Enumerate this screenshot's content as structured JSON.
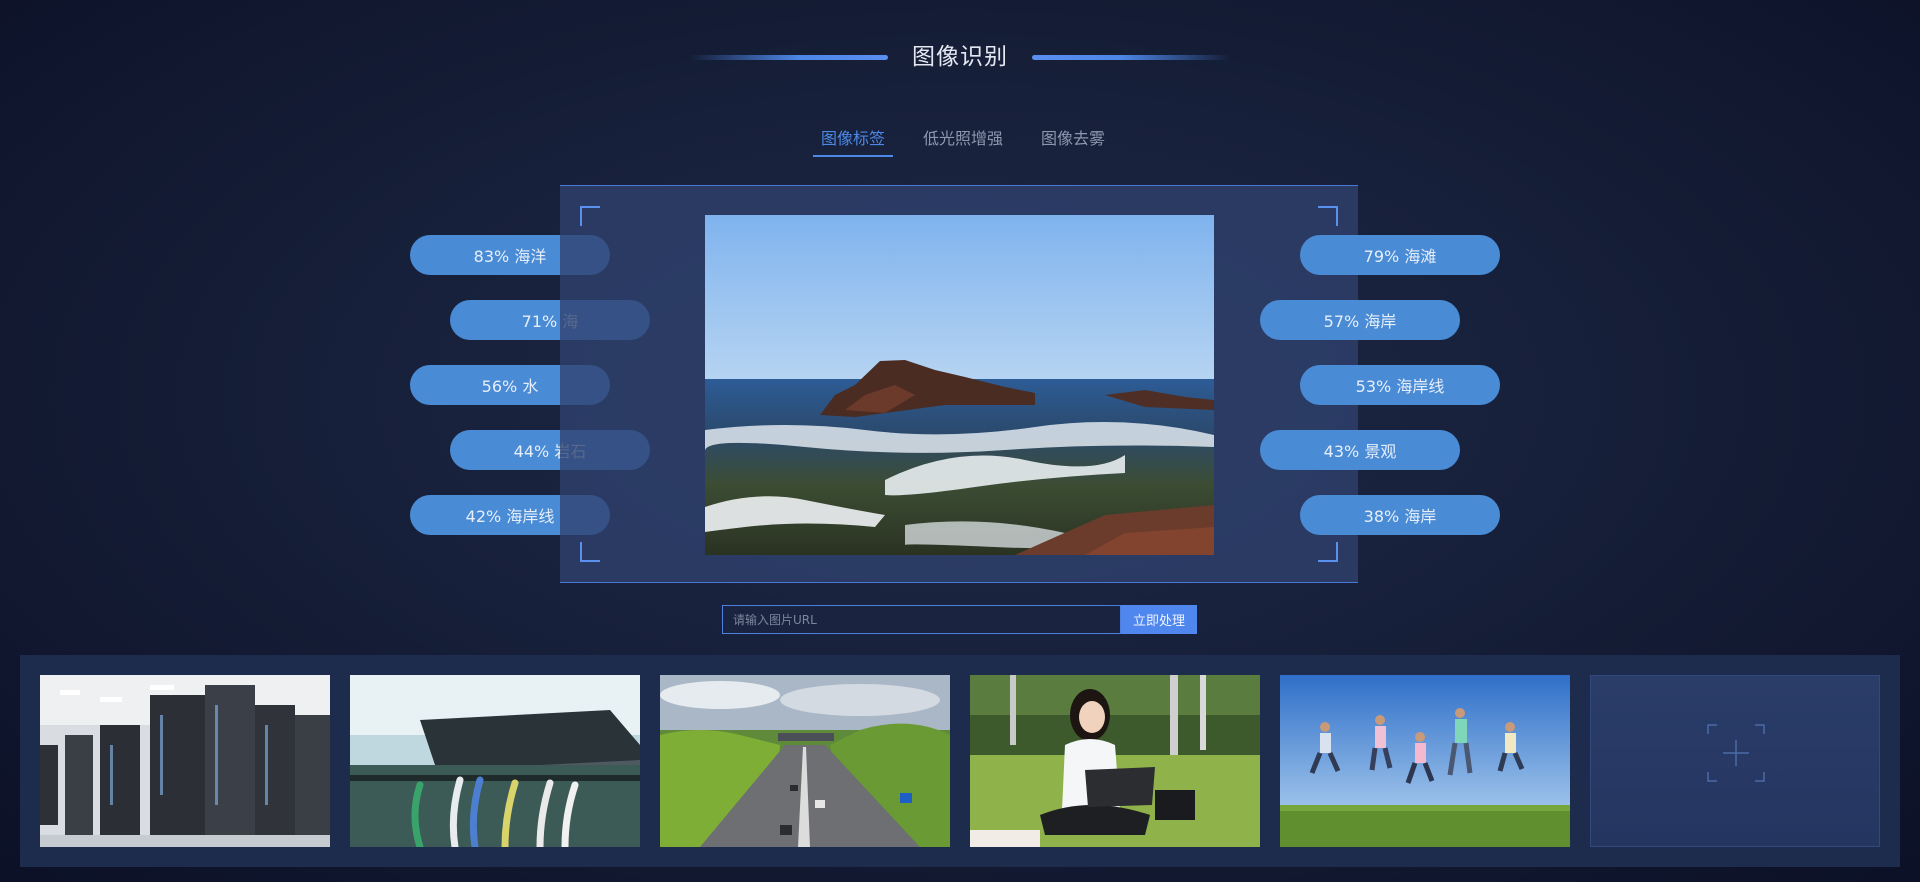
{
  "header": {
    "title": "图像识别"
  },
  "tabs": [
    {
      "label": "图像标签",
      "active": true
    },
    {
      "label": "低光照增强",
      "active": false
    },
    {
      "label": "图像去雾",
      "active": false
    }
  ],
  "tags_left": [
    {
      "label": "83% 海洋"
    },
    {
      "label": "71% 海"
    },
    {
      "label": "56% 水"
    },
    {
      "label": "44% 岩石"
    },
    {
      "label": "42% 海岸线"
    }
  ],
  "tags_right": [
    {
      "label": "79% 海滩"
    },
    {
      "label": "57% 海岸"
    },
    {
      "label": "53% 海岸线"
    },
    {
      "label": "43% 景观"
    },
    {
      "label": "38% 海岸"
    }
  ],
  "url_form": {
    "placeholder": "请输入图片URL",
    "value": "",
    "button_label": "立即处理"
  },
  "thumbnails": [
    {
      "icon": "server-room-photo"
    },
    {
      "icon": "network-router-photo"
    },
    {
      "icon": "highway-photo"
    },
    {
      "icon": "woman-laptop-photo"
    },
    {
      "icon": "jumping-people-photo"
    },
    {
      "icon": "add-image-icon"
    }
  ],
  "colors": {
    "accent": "#4c89e6",
    "tag_bg": "#4a8bd6",
    "button_bg": "#4f87ee"
  }
}
